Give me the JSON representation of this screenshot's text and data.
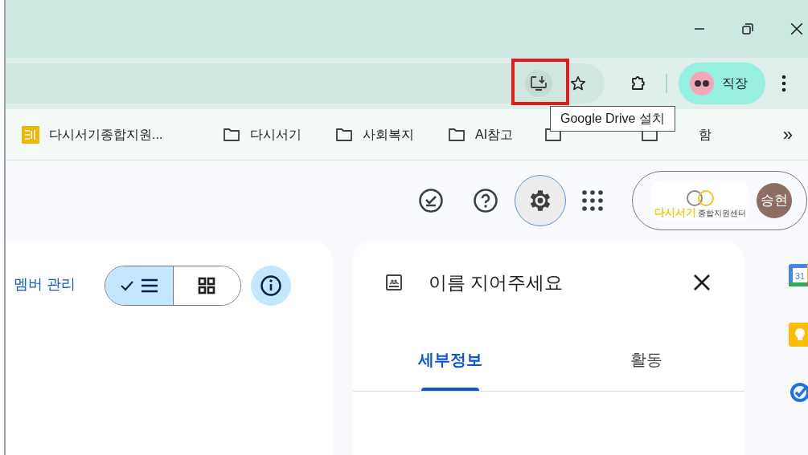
{
  "window": {
    "controls": [
      {
        "kind": "minimize"
      },
      {
        "kind": "restore"
      },
      {
        "kind": "close"
      }
    ]
  },
  "toolbar": {
    "install_highlighted": true,
    "profile": {
      "label": "직장"
    }
  },
  "tooltip": {
    "text": "Google Drive 설치"
  },
  "bookmarks": [
    {
      "kind": "site",
      "label": "다시서기종합지원..."
    },
    {
      "kind": "folder",
      "label": "다시서기"
    },
    {
      "kind": "folder",
      "label": "사회복지"
    },
    {
      "kind": "folder",
      "label": "AI참고"
    },
    {
      "kind": "folder"
    },
    {
      "kind": "folder",
      "label": "함"
    }
  ],
  "bookmarks_more": "»",
  "header": {
    "settings_selected": true,
    "org_logo": {
      "name": "다시서기",
      "subtitle": "종합지원센터"
    },
    "avatar": "승현"
  },
  "left_panel": {
    "link": "멤버 관리",
    "view_toggle": [
      {
        "kind": "list",
        "selected": true
      },
      {
        "kind": "grid",
        "selected": false
      }
    ],
    "info_selected": true
  },
  "details": {
    "title": "이름 지어주세요",
    "tabs": [
      {
        "label": "세부정보",
        "selected": true
      },
      {
        "label": "활동",
        "selected": false
      }
    ]
  },
  "side_apps": [
    {
      "kind": "calendar",
      "label": "31"
    },
    {
      "kind": "keep"
    },
    {
      "kind": "tasks"
    }
  ]
}
